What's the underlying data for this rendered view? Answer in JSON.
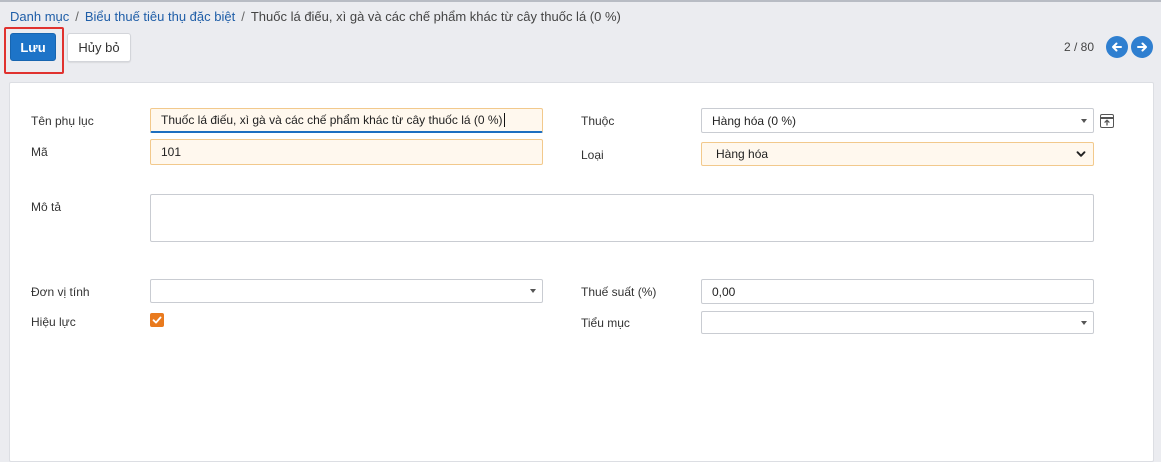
{
  "breadcrumb": {
    "items": [
      "Danh mục",
      "Biểu thuế tiêu thụ đặc biệt"
    ],
    "separator": "/",
    "current": "Thuốc lá điếu, xì gà và các chế phẩm khác từ cây thuốc lá (0 %)"
  },
  "toolbar": {
    "save_label": "Lưu",
    "cancel_label": "Hủy bỏ"
  },
  "pager": {
    "text": "2 / 80",
    "prev_icon": "arrow-left-icon",
    "next_icon": "arrow-right-icon"
  },
  "form": {
    "ten_phu_luc": {
      "label": "Tên phụ lục",
      "value": "Thuốc lá điếu, xì gà và các chế phẩm khác từ cây thuốc lá (0 %)"
    },
    "ma": {
      "label": "Mã",
      "value": "101"
    },
    "thuoc": {
      "label": "Thuộc",
      "value": "Hàng hóa (0 %)",
      "icon": "external-link-icon"
    },
    "loai": {
      "label": "Loại",
      "value": "Hàng hóa"
    },
    "mo_ta": {
      "label": "Mô tả",
      "value": ""
    },
    "don_vi_tinh": {
      "label": "Đơn vị tính",
      "value": ""
    },
    "hieu_luc": {
      "label": "Hiệu lực",
      "checked": true
    },
    "thue_suat": {
      "label": "Thuế suất (%)",
      "value": "0,00"
    },
    "tieu_muc": {
      "label": "Tiểu mục",
      "value": ""
    }
  },
  "colors": {
    "primary": "#1d74c8",
    "link": "#1f5ea8",
    "required_bg": "#fff8ee",
    "required_border": "#f2c98c",
    "checkbox": "#e97a1e",
    "highlight": "#e0322f"
  }
}
